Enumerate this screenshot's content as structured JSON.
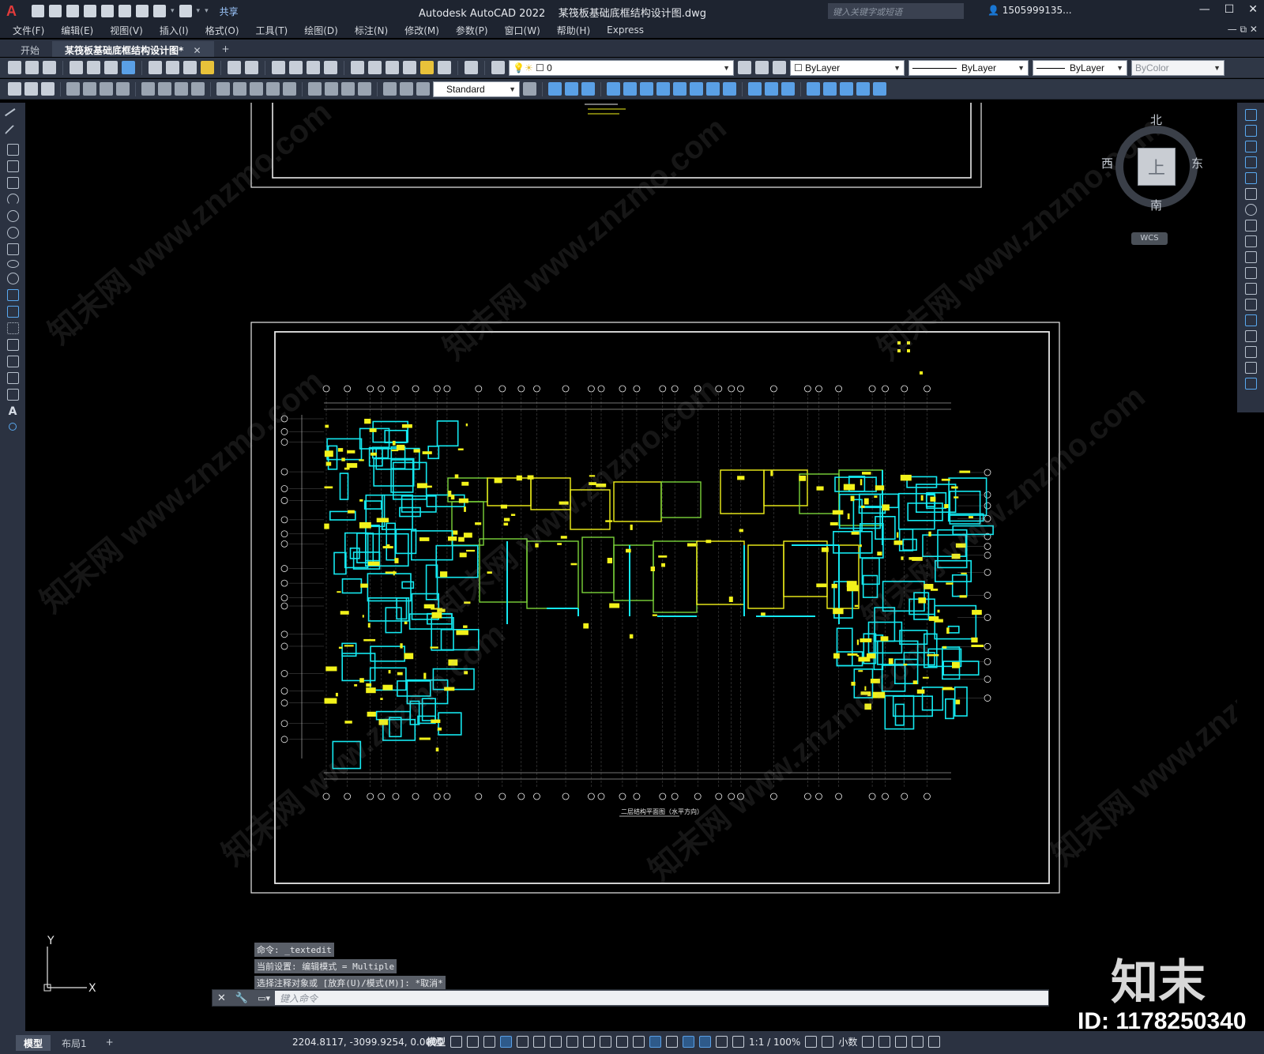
{
  "titlebar": {
    "logo": "A",
    "share": "共享",
    "app_title": "Autodesk AutoCAD 2022",
    "file_name": "某筏板基础底框结构设计图.dwg",
    "search_placeholder": "键入关键字或短语",
    "user": "1505999135...",
    "window_controls": [
      "—",
      "☐",
      "✕"
    ]
  },
  "menubar": {
    "items": [
      "文件(F)",
      "编辑(E)",
      "视图(V)",
      "插入(I)",
      "格式(O)",
      "工具(T)",
      "绘图(D)",
      "标注(N)",
      "修改(M)",
      "参数(P)",
      "窗口(W)",
      "帮助(H)",
      "Express"
    ],
    "right_controls": "— ⧉ ✕"
  },
  "tabs": {
    "start": "开始",
    "active": "某筏板基础底框结构设计图*",
    "close": "✕",
    "plus": "+"
  },
  "toolbar1": {
    "layer_value": "0",
    "color_value": "ByLayer",
    "linetype_value": "ByLayer",
    "lineweight_value": "ByLayer",
    "plotstyle_value": "ByColor"
  },
  "toolbar2": {
    "text_style": "Standard"
  },
  "viewcube": {
    "north": "北",
    "south": "南",
    "east": "东",
    "west": "西",
    "face": "上",
    "wcs": "WCS"
  },
  "drawing": {
    "plan_title": "二层结构平面图（水平方向）",
    "colors": {
      "cyan": "#14e8f0",
      "yellow": "#f2f21a",
      "green": "#7ad43a",
      "white": "#e8e8e8"
    }
  },
  "ucs": {
    "y": "Y",
    "x": "X"
  },
  "command": {
    "history": [
      "命令: _textedit",
      "当前设置: 编辑模式 = Multiple",
      "选择注释对象或 [放弃(U)/模式(M)]: *取消*"
    ],
    "input_placeholder": "键入命令"
  },
  "watermark": {
    "brand": "知末",
    "id": "ID: 1178250340",
    "site_text": "知末网 www.znzmo.com"
  },
  "statusbar": {
    "layout_tabs": [
      "模型",
      "布局1"
    ],
    "add": "+",
    "coords": "2204.8117, -3099.9254, 0.0000",
    "model": "模型",
    "scale": "1:1 / 100%",
    "units": "小数"
  }
}
